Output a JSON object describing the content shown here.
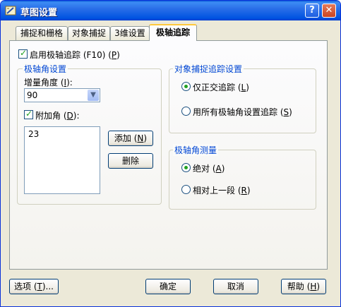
{
  "window": {
    "title": "草图设置",
    "help_glyph": "?",
    "close_glyph": "✕"
  },
  "tabs": [
    {
      "label": "捕捉和栅格",
      "active": false
    },
    {
      "label": "对象捕捉",
      "active": false
    },
    {
      "label": "3维设置",
      "active": false
    },
    {
      "label": "极轴追踪",
      "active": true
    }
  ],
  "polar": {
    "enable_label": "启用极轴追踪",
    "enable_shortcut": "(F10)",
    "enable_mnemonic": "P",
    "enable_checked": true
  },
  "angle_settings": {
    "group_title": "极轴角设置",
    "increment_label": "增量角度",
    "increment_mnemonic": "I",
    "increment_value": "90",
    "additional_label": "附加角",
    "additional_mnemonic": "D",
    "additional_checked": true,
    "additional_angles": [
      "23"
    ],
    "add_button": "添加",
    "add_mnemonic": "N",
    "delete_button": "删除"
  },
  "snap_tracking": {
    "group_title": "对象捕捉追踪设置",
    "orthogonal_label": "仅正交追踪",
    "orthogonal_mnemonic": "L",
    "orthogonal_selected": true,
    "all_polar_label": "用所有极轴角设置追踪",
    "all_polar_mnemonic": "S",
    "all_polar_selected": false
  },
  "polar_measure": {
    "group_title": "极轴角测量",
    "absolute_label": "绝对",
    "absolute_mnemonic": "A",
    "absolute_selected": true,
    "relative_label": "相对上一段",
    "relative_mnemonic": "R",
    "relative_selected": false
  },
  "footer": {
    "options_label": "选项",
    "options_mnemonic": "T",
    "ok_label": "确定",
    "cancel_label": "取消",
    "help_label": "帮助",
    "help_mnemonic": "H"
  },
  "icons": {
    "app": "drafting-settings-icon",
    "checkbox_tick": "✓",
    "combo_arrow": "▼"
  },
  "colors": {
    "title_bar": "#0a5bd6",
    "group_title": "#0046d5",
    "check_mark": "#21a121",
    "active_tab_highlight": "#ffc83c"
  }
}
